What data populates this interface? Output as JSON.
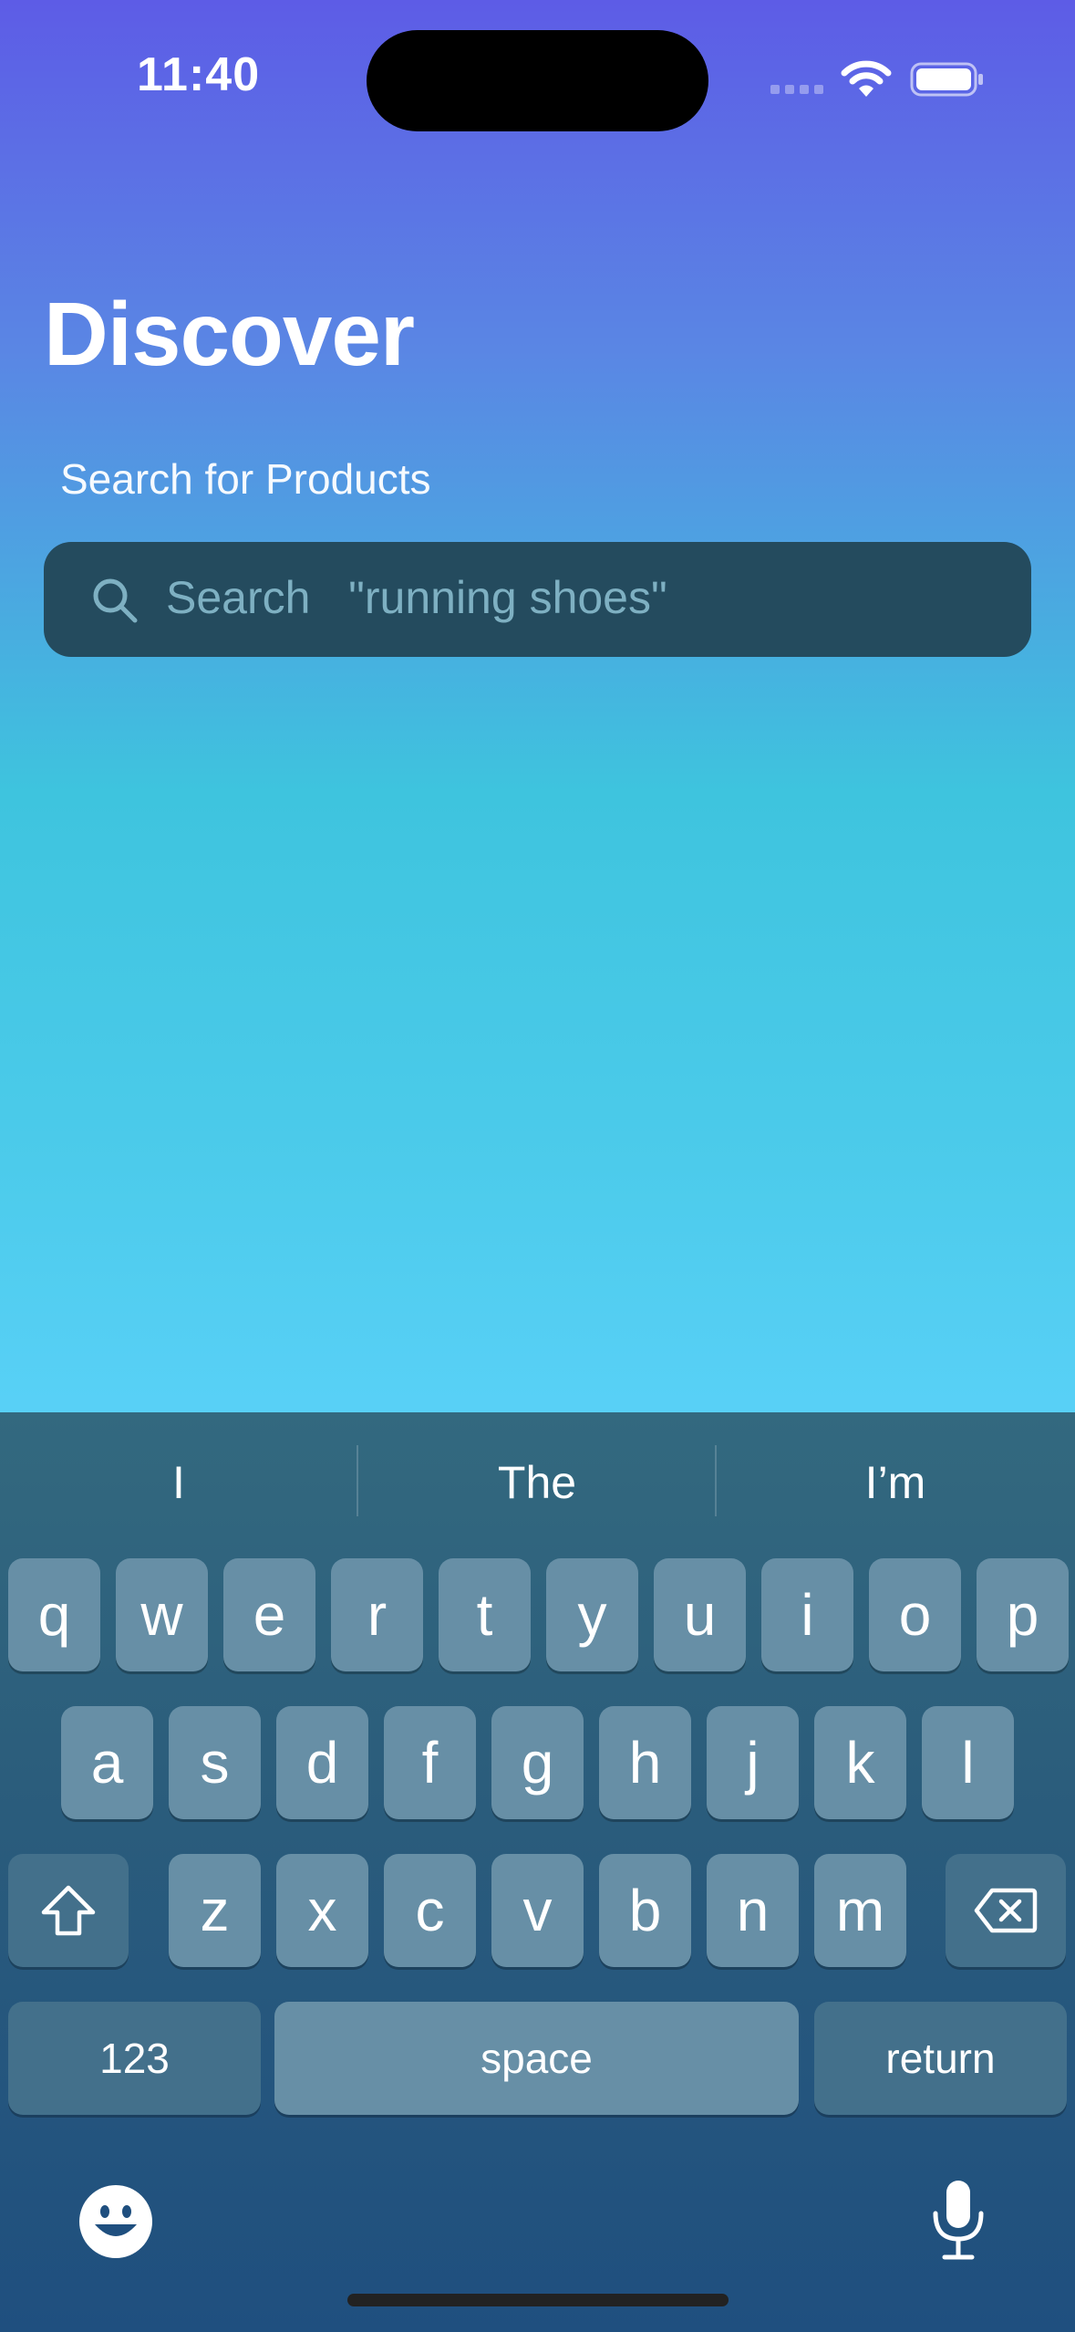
{
  "status_bar": {
    "time": "11:40"
  },
  "page": {
    "title": "Discover",
    "subtitle": "Search for Products",
    "search": {
      "label": "Search",
      "example": "\"running shoes\""
    }
  },
  "keyboard": {
    "suggestions": [
      "I",
      "The",
      "I’m"
    ],
    "row1": [
      "q",
      "w",
      "e",
      "r",
      "t",
      "y",
      "u",
      "i",
      "o",
      "p"
    ],
    "row2": [
      "a",
      "s",
      "d",
      "f",
      "g",
      "h",
      "j",
      "k",
      "l"
    ],
    "row3": [
      "z",
      "x",
      "c",
      "v",
      "b",
      "n",
      "m"
    ],
    "numbers_label": "123",
    "space_label": "space",
    "return_label": "return"
  },
  "icons": {
    "search": "magnifying-glass",
    "shift": "shift-arrow",
    "delete": "backspace",
    "emoji": "smiley-face",
    "dictation": "microphone"
  }
}
